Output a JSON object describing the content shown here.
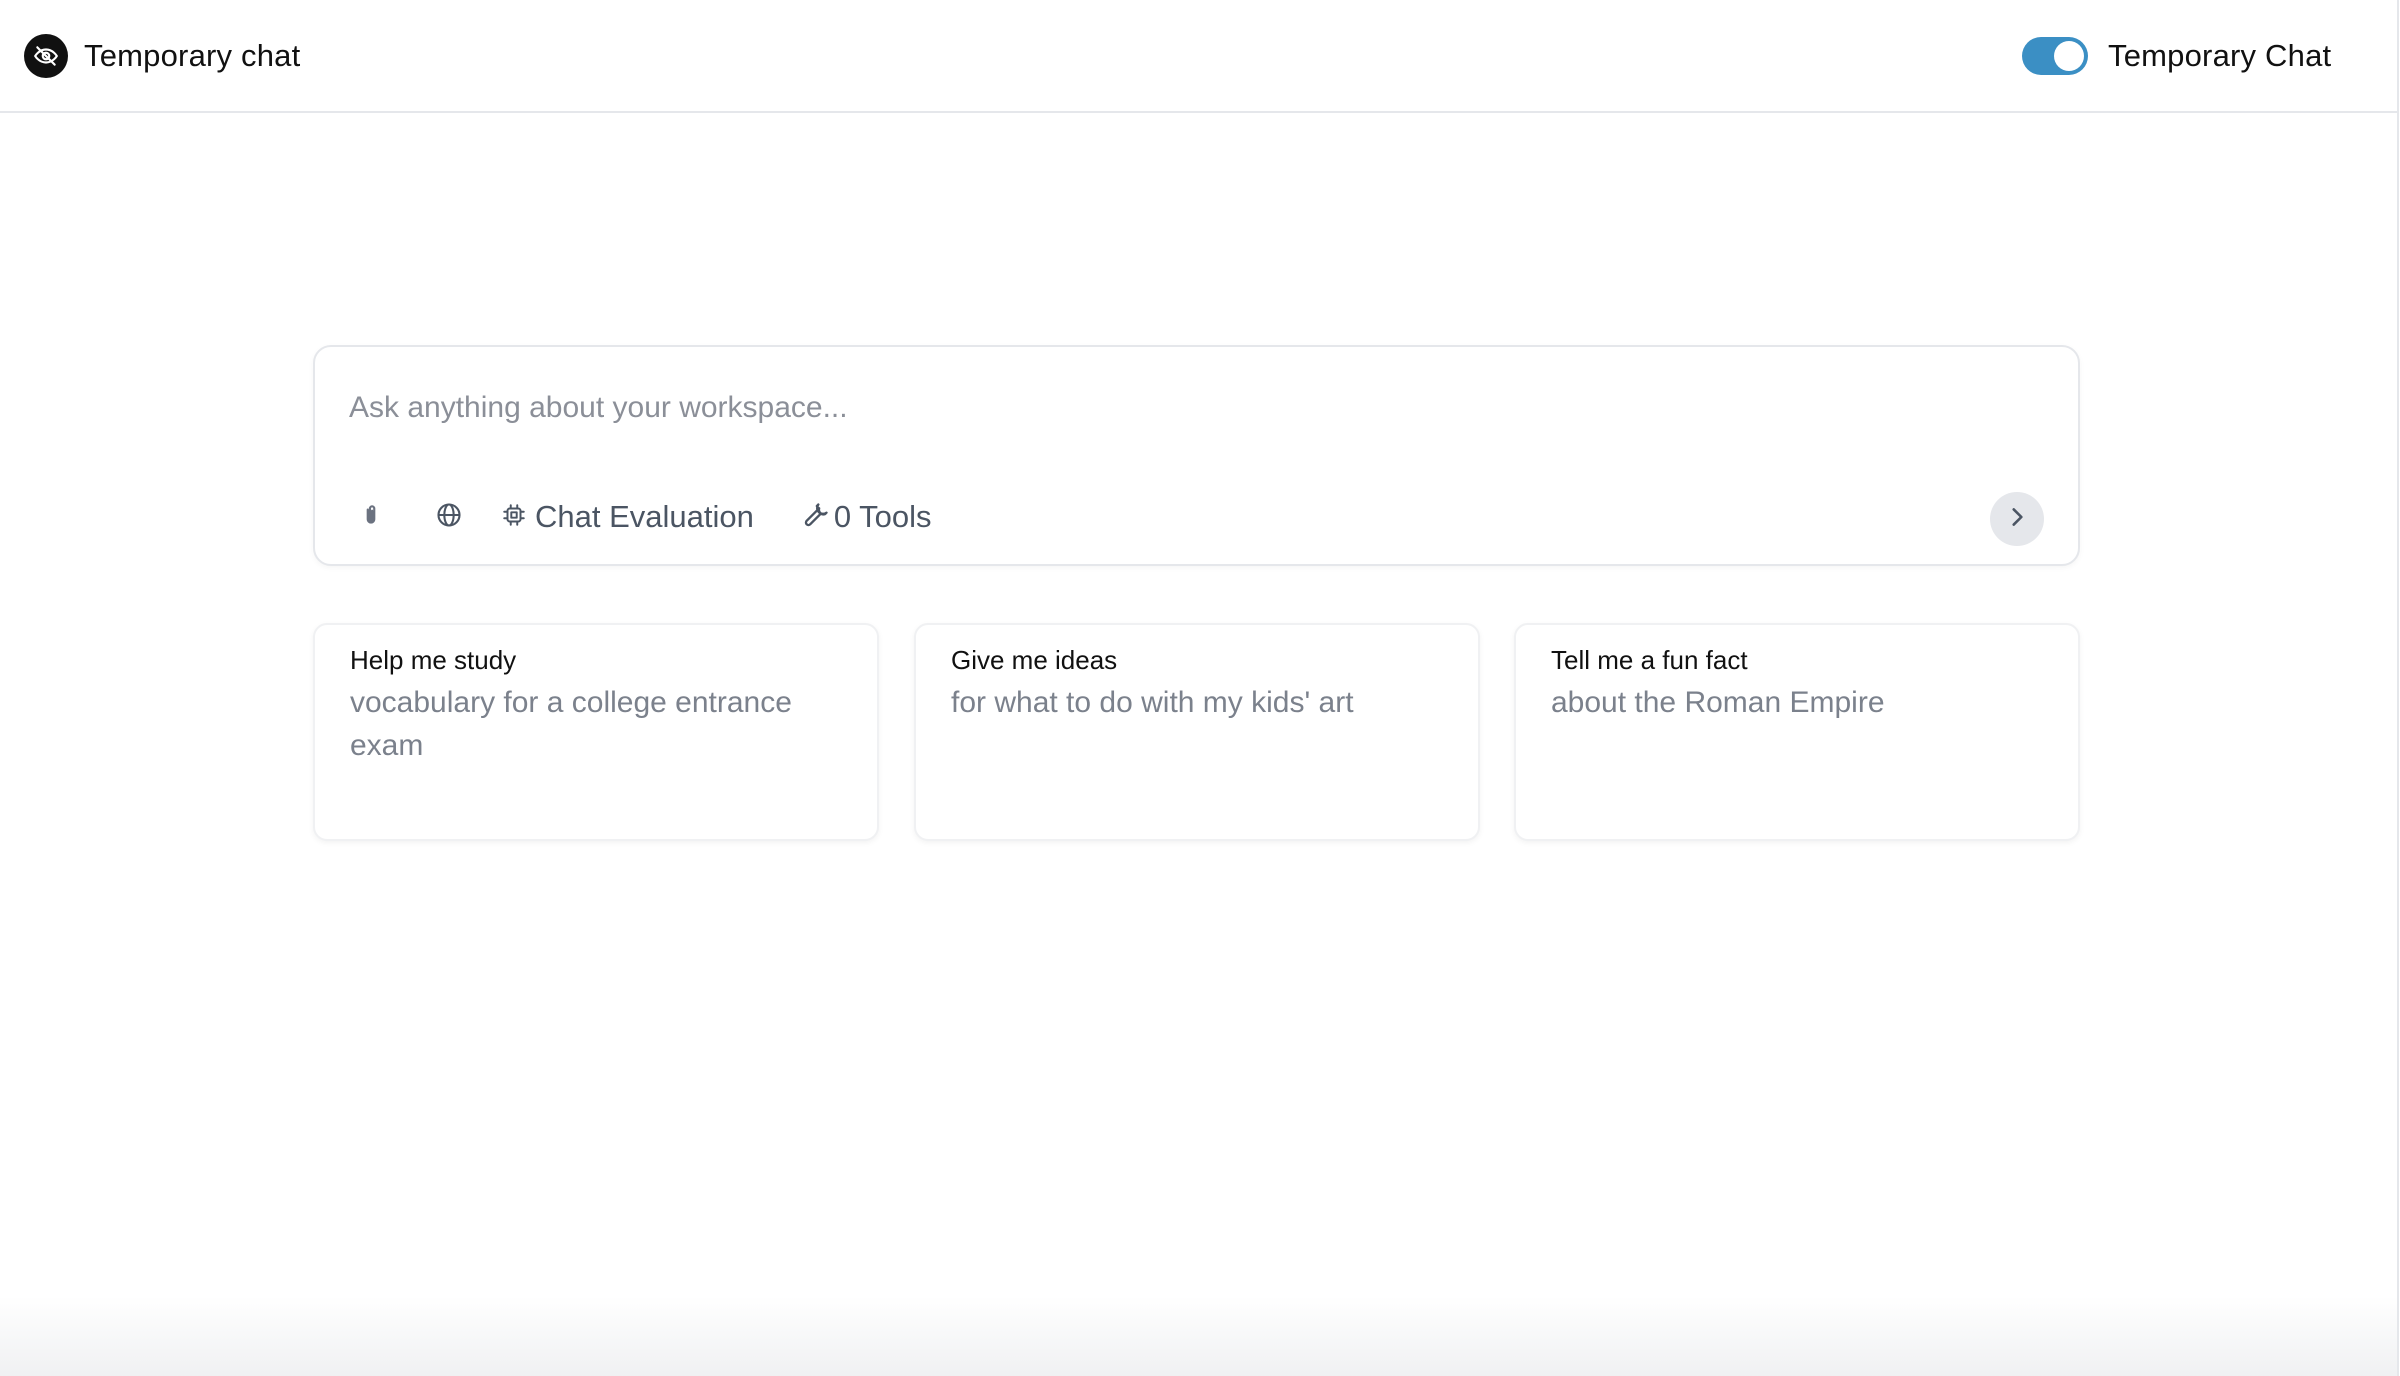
{
  "header": {
    "title": "Temporary chat",
    "incognito_icon": "eye-off-icon",
    "toggle": {
      "label": "Temporary Chat",
      "state": "on",
      "accent_color": "#3b8fc4"
    }
  },
  "composer": {
    "placeholder": "Ask anything about your workspace...",
    "value": "",
    "toolbar": {
      "attach_icon": "paperclip-icon",
      "web_search_icon": "globe-icon",
      "model": {
        "icon": "chip-icon",
        "label": "Chat Evaluation"
      },
      "tools": {
        "icon": "wrench-icon",
        "label": "0 Tools"
      },
      "send_icon": "chevron-right-icon"
    }
  },
  "suggestions": [
    {
      "title": "Help me study",
      "subtitle": "vocabulary for a college entrance exam"
    },
    {
      "title": "Give me ideas",
      "subtitle": "for what to do with my kids' art"
    },
    {
      "title": "Tell me a fun fact",
      "subtitle": "about the Roman Empire"
    }
  ]
}
